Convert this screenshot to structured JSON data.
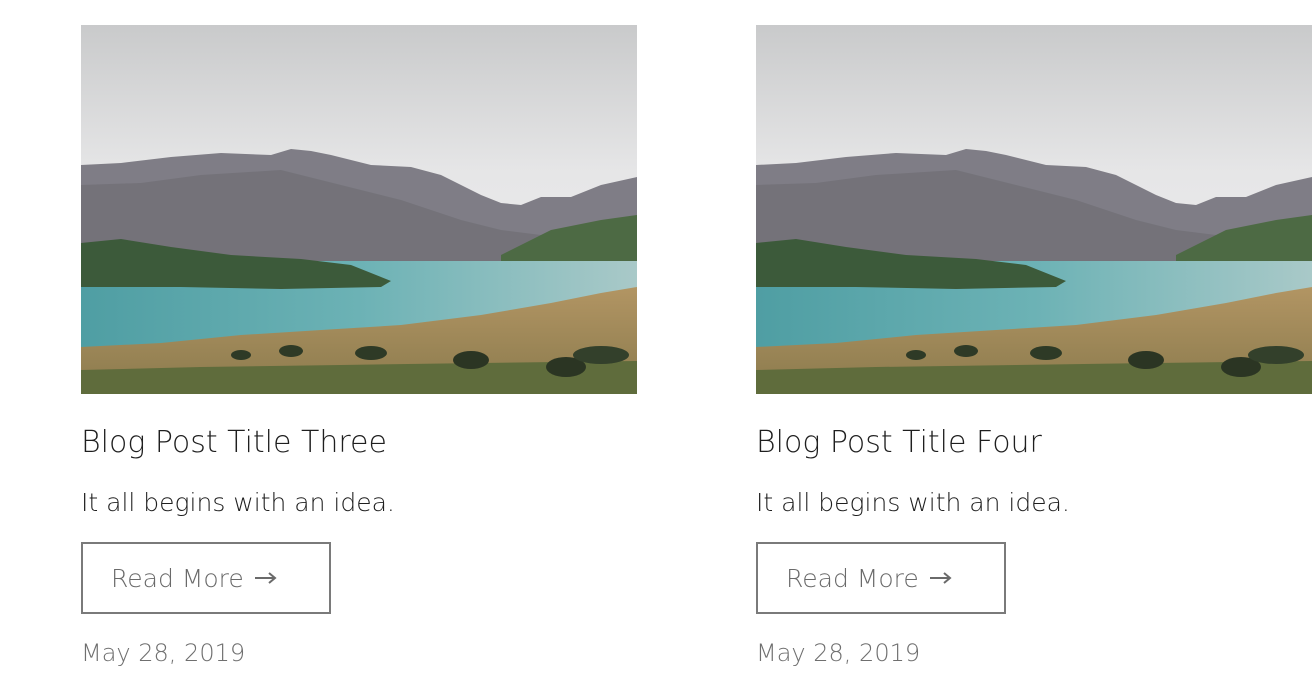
{
  "posts": [
    {
      "image_alt": "lake-mountain-landscape",
      "title": "Blog Post Title Three",
      "excerpt": "It all begins with an idea.",
      "read_more_label": "Read More",
      "arrow_icon": "arrow-right-icon",
      "date": "May 28, 2019"
    },
    {
      "image_alt": "lake-mountain-landscape",
      "title": "Blog Post Title Four",
      "excerpt": "It all begins with an idea.",
      "read_more_label": "Read More",
      "arrow_icon": "arrow-right-icon",
      "date": "May 28, 2019"
    }
  ],
  "colors": {
    "text_dark": "#1f1f1f",
    "text_muted": "#6a6a6a",
    "button_border": "#7a7a7a",
    "sky": "#d9dadb",
    "lake": "#5fa7ab",
    "mountain": "#7f7d86",
    "island": "#3c5a3a",
    "grass": "#b49a62"
  }
}
